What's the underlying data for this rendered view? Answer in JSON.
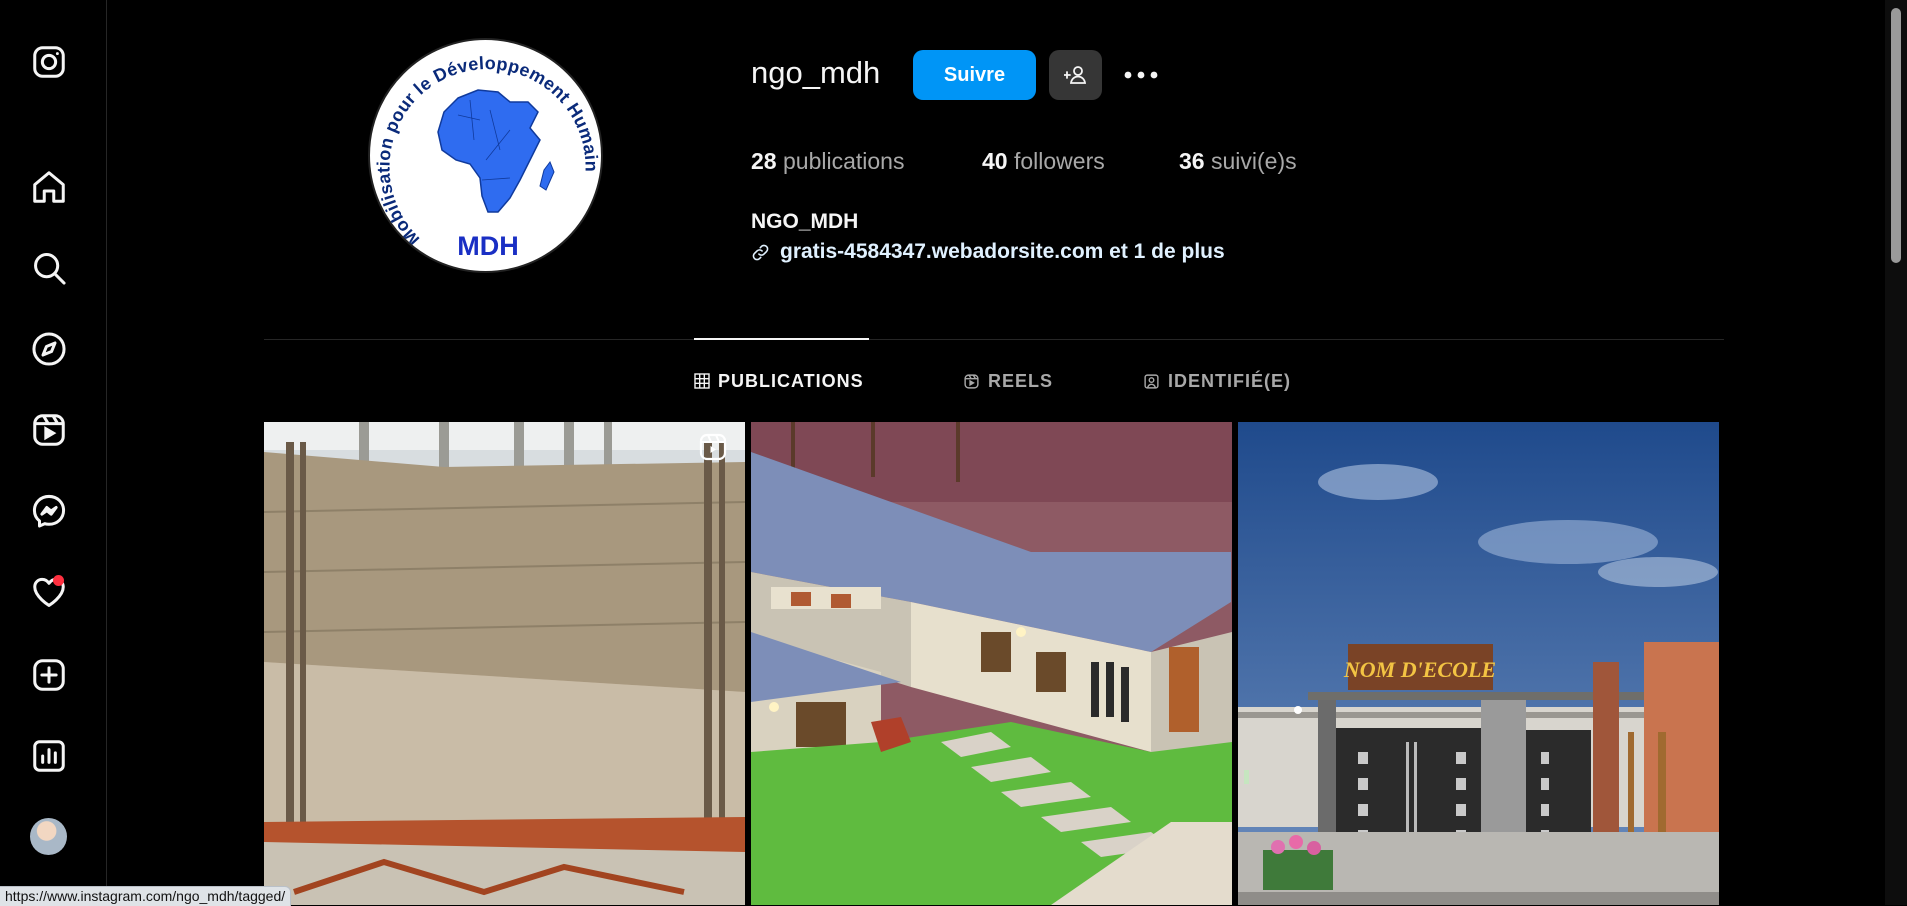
{
  "profile": {
    "username": "ngo_mdh",
    "follow_label": "Suivre",
    "stats": [
      {
        "count": "28",
        "label": " publications"
      },
      {
        "count": "40",
        "label": " followers"
      },
      {
        "count": "36",
        "label": " suivi(e)s"
      }
    ],
    "display_name": "NGO_MDH",
    "link_text": "gratis-4584347.webadorsite.com et 1 de plus",
    "logo_text_circle": "Mobilisation pour le Développement Humain",
    "logo_abbrev": "MDH"
  },
  "tabs": [
    {
      "label": "PUBLICATIONS",
      "icon": "grid-icon",
      "active": true
    },
    {
      "label": "REELS",
      "icon": "reels-icon",
      "active": false
    },
    {
      "label": "IDENTIFIÉ(E)",
      "icon": "tagged-icon",
      "active": false
    }
  ],
  "posts": [
    {
      "kind": "reel",
      "subject": "construction-wall"
    },
    {
      "kind": "photo",
      "subject": "house-render"
    },
    {
      "kind": "photo",
      "subject": "school-facade",
      "sign_text": "NOM D'ECOLE"
    }
  ],
  "sidebar_icons": [
    "instagram-icon",
    "home-icon",
    "search-icon",
    "explore-icon",
    "reels-icon",
    "messenger-icon",
    "heart-icon",
    "create-icon",
    "dashboard-icon"
  ],
  "status_bar": {
    "url": "https://www.instagram.com/ngo_mdh/tagged/"
  },
  "colors": {
    "background": "#000000",
    "accent": "#0095f6",
    "notification": "#ff3040",
    "logo_blue": "#2f6cf0"
  }
}
